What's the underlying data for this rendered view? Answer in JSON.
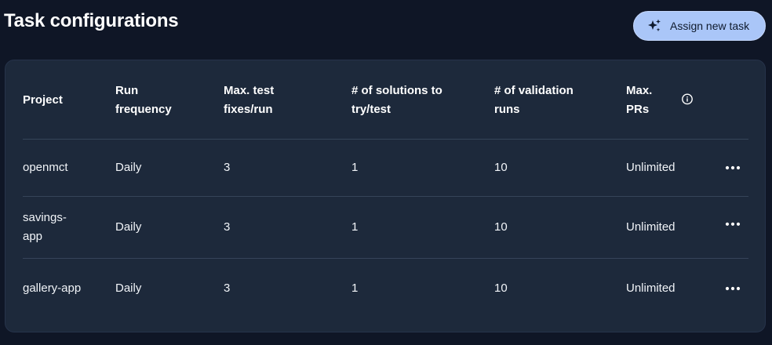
{
  "header": {
    "title": "Task configurations",
    "assign_button_label": "Assign new task"
  },
  "table": {
    "columns": [
      {
        "line1": "Project",
        "line2": ""
      },
      {
        "line1": "Run",
        "line2": "frequency"
      },
      {
        "line1": "Max. test",
        "line2": "fixes/run"
      },
      {
        "line1": "# of solutions to",
        "line2": "try/test"
      },
      {
        "line1": "# of validation",
        "line2": "runs"
      },
      {
        "line1": "Max.",
        "line2": "PRs"
      }
    ],
    "rows": [
      {
        "project_line1": "openmct",
        "project_line2": "",
        "frequency": "Daily",
        "max_fixes": "3",
        "solutions": "1",
        "validation_runs": "10",
        "max_prs": "Unlimited"
      },
      {
        "project_line1": "savings-",
        "project_line2": "app",
        "frequency": "Daily",
        "max_fixes": "3",
        "solutions": "1",
        "validation_runs": "10",
        "max_prs": "Unlimited"
      },
      {
        "project_line1": "gallery-app",
        "project_line2": "",
        "frequency": "Daily",
        "max_fixes": "3",
        "solutions": "1",
        "validation_runs": "10",
        "max_prs": "Unlimited"
      }
    ]
  },
  "icons": {
    "assign": "sparkle-icon",
    "info": "info-icon",
    "row_menu": "more-horizontal-icon"
  },
  "colors": {
    "page_background": "#0f1626",
    "panel_background": "#1d293b",
    "divider": "#364459",
    "button_background": "#aac6f8",
    "button_text": "#0f1a2c",
    "text": "#ffffff"
  }
}
